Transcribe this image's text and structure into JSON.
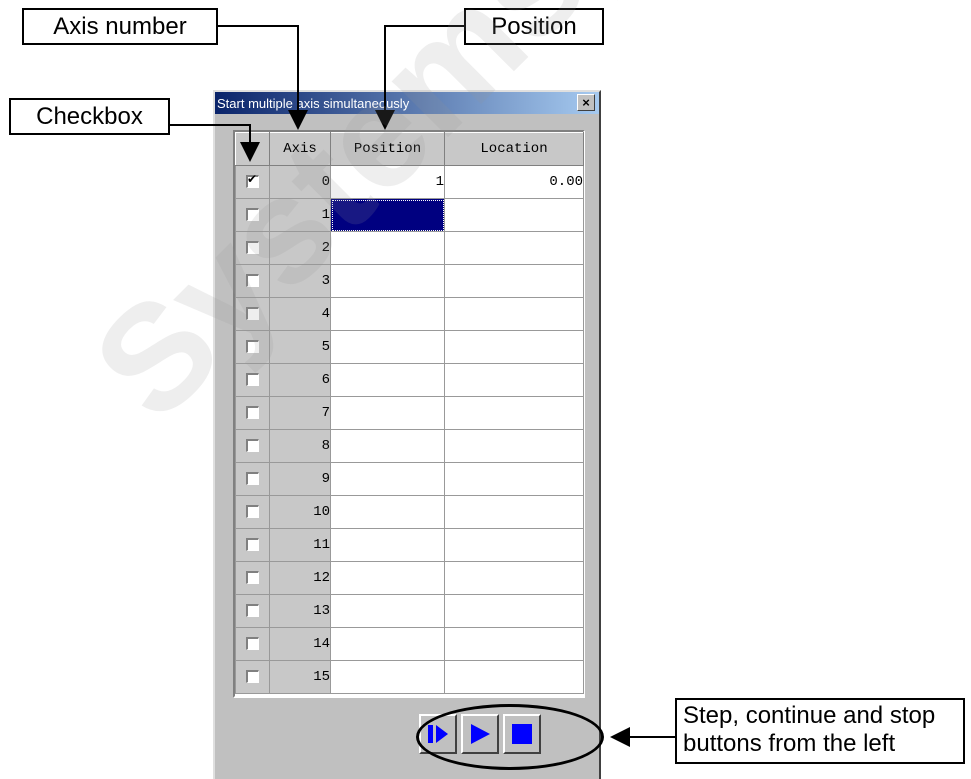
{
  "callouts": {
    "axis_number": "Axis number",
    "position": "Position",
    "checkbox": "Checkbox",
    "buttons_line1": "Step, continue and stop",
    "buttons_line2": "buttons from the left"
  },
  "window": {
    "title": "Start multiple axis simultaneously",
    "close_glyph": "×"
  },
  "grid": {
    "columns": [
      "",
      "Axis",
      "Position",
      "Location"
    ],
    "rows": [
      {
        "checked": true,
        "axis": "0",
        "position": "1",
        "location": "0.00"
      },
      {
        "checked": false,
        "axis": "1",
        "position": "",
        "location": "",
        "selected": true
      },
      {
        "checked": false,
        "axis": "2",
        "position": "",
        "location": ""
      },
      {
        "checked": false,
        "axis": "3",
        "position": "",
        "location": ""
      },
      {
        "checked": false,
        "axis": "4",
        "position": "",
        "location": ""
      },
      {
        "checked": false,
        "axis": "5",
        "position": "",
        "location": ""
      },
      {
        "checked": false,
        "axis": "6",
        "position": "",
        "location": ""
      },
      {
        "checked": false,
        "axis": "7",
        "position": "",
        "location": ""
      },
      {
        "checked": false,
        "axis": "8",
        "position": "",
        "location": ""
      },
      {
        "checked": false,
        "axis": "9",
        "position": "",
        "location": ""
      },
      {
        "checked": false,
        "axis": "10",
        "position": "",
        "location": ""
      },
      {
        "checked": false,
        "axis": "11",
        "position": "",
        "location": ""
      },
      {
        "checked": false,
        "axis": "12",
        "position": "",
        "location": ""
      },
      {
        "checked": false,
        "axis": "13",
        "position": "",
        "location": ""
      },
      {
        "checked": false,
        "axis": "14",
        "position": "",
        "location": ""
      },
      {
        "checked": false,
        "axis": "15",
        "position": "",
        "location": ""
      }
    ]
  },
  "buttons": [
    {
      "name": "step-button",
      "icon": "step-icon"
    },
    {
      "name": "continue-button",
      "icon": "play-icon"
    },
    {
      "name": "stop-button",
      "icon": "stop-icon"
    }
  ],
  "colors": {
    "icon_blue": "#0000ff",
    "selection": "#000080",
    "title_gradient_start": "#0a246a"
  },
  "watermark": "Systems, Inc. www.air"
}
